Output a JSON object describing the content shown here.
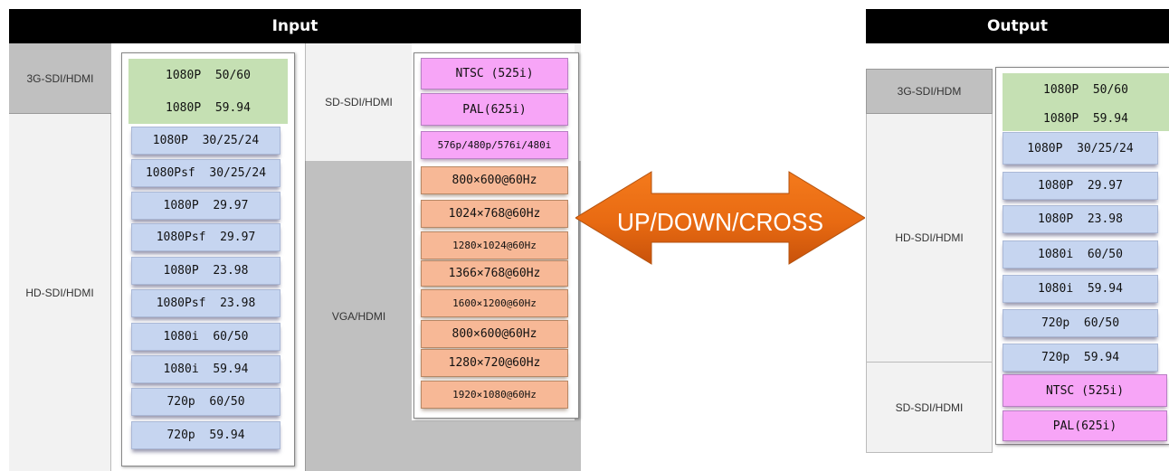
{
  "input": {
    "title": "Input",
    "rows": {
      "sdi3g": "3G-SDI/HDMI",
      "hdsdi": "HD-SDI/HDMI",
      "sdsdi": "SD-SDI/HDMI",
      "vga": "VGA/HDMI"
    },
    "formats_3g": [
      "1080P  50/60",
      "1080P  59.94"
    ],
    "formats_hd": [
      "1080P  30/25/24",
      "1080Psf  30/25/24",
      "1080P  29.97",
      "1080Psf  29.97",
      "1080P  23.98",
      "1080Psf  23.98",
      "1080i  60/50",
      "1080i  59.94",
      "720p  60/50",
      "720p  59.94"
    ],
    "formats_sd": [
      "NTSC (525i)",
      "PAL(625i)",
      "576p/480p/576i/480i"
    ],
    "formats_vga": [
      "800×600@60Hz",
      "1024×768@60Hz",
      "1280×1024@60Hz",
      "1366×768@60Hz",
      "1600×1200@60Hz",
      "800×600@60Hz",
      "1280×720@60Hz",
      "1920×1080@60Hz"
    ]
  },
  "arrow": {
    "label": "UP/DOWN/CROSS"
  },
  "output": {
    "title": "Output",
    "rows": {
      "sdi3g": "3G-SDI/HDM",
      "hdsdi": "HD-SDI/HDMI",
      "sdsdi": "SD-SDI/HDMI"
    },
    "formats_3g": [
      "1080P  50/60",
      "1080P  59.94"
    ],
    "formats_hd": [
      "1080P  30/25/24",
      "1080P  29.97",
      "1080P  23.98",
      "1080i  60/50",
      "1080i  59.94",
      "720p  60/50",
      "720p  59.94"
    ],
    "formats_sd": [
      "NTSC (525i)",
      "PAL(625i)"
    ]
  },
  "colors": {
    "sdi3g": "#c5e0b3",
    "hd": "#c6d5f0",
    "sd": "#f7a5f7",
    "vga": "#f7b896",
    "arrow": "#f06a10",
    "row_gray": "#c0c0c0",
    "row_light": "#f2f2f2"
  }
}
